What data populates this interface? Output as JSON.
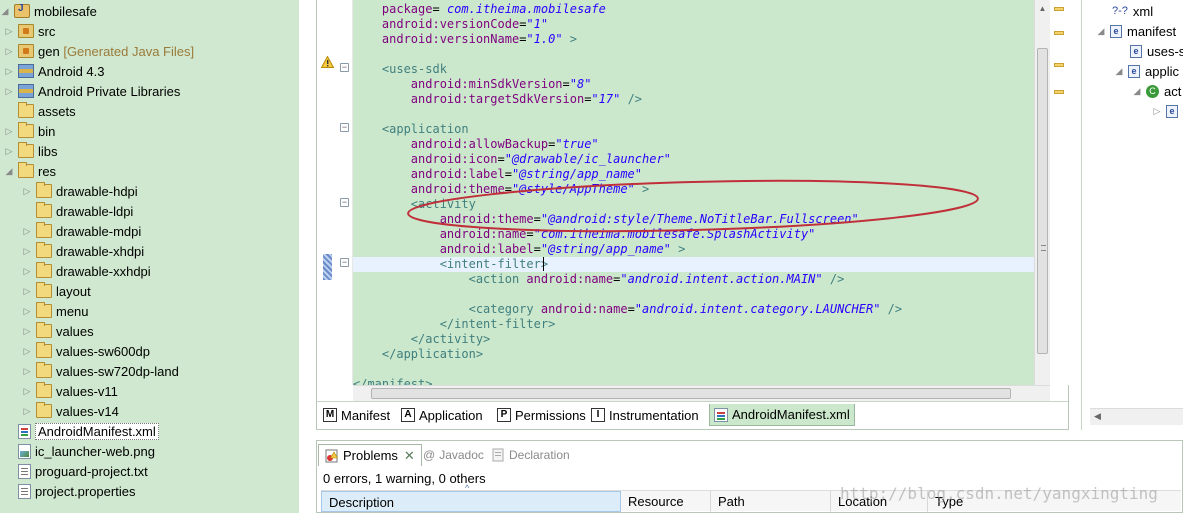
{
  "explorer": {
    "items": [
      {
        "label": "mobilesafe",
        "icon": "project-icon",
        "twisty": "open"
      },
      {
        "label": "src",
        "icon": "source-folder-icon",
        "twisty": "closed"
      },
      {
        "label": "gen",
        "extra": "[Generated Java Files]",
        "icon": "source-folder-icon",
        "twisty": "closed"
      },
      {
        "label": "Android 4.3",
        "icon": "library-icon",
        "twisty": "closed"
      },
      {
        "label": "Android Private Libraries",
        "icon": "library-icon",
        "twisty": "closed"
      },
      {
        "label": "assets",
        "icon": "folder-icon",
        "twisty": "none"
      },
      {
        "label": "bin",
        "icon": "folder-icon",
        "twisty": "closed"
      },
      {
        "label": "libs",
        "icon": "folder-icon",
        "twisty": "closed"
      },
      {
        "label": "res",
        "icon": "folder-icon",
        "twisty": "open"
      },
      {
        "label": "drawable-hdpi",
        "icon": "folder-icon",
        "twisty": "closed"
      },
      {
        "label": "drawable-ldpi",
        "icon": "folder-icon",
        "twisty": "none"
      },
      {
        "label": "drawable-mdpi",
        "icon": "folder-icon",
        "twisty": "closed"
      },
      {
        "label": "drawable-xhdpi",
        "icon": "folder-icon",
        "twisty": "closed"
      },
      {
        "label": "drawable-xxhdpi",
        "icon": "folder-icon",
        "twisty": "closed"
      },
      {
        "label": "layout",
        "icon": "folder-icon",
        "twisty": "closed"
      },
      {
        "label": "menu",
        "icon": "folder-icon",
        "twisty": "closed"
      },
      {
        "label": "values",
        "icon": "folder-icon",
        "twisty": "closed"
      },
      {
        "label": "values-sw600dp",
        "icon": "folder-icon",
        "twisty": "closed"
      },
      {
        "label": "values-sw720dp-land",
        "icon": "folder-icon",
        "twisty": "closed"
      },
      {
        "label": "values-v11",
        "icon": "folder-icon",
        "twisty": "closed"
      },
      {
        "label": "values-v14",
        "icon": "folder-icon",
        "twisty": "closed"
      },
      {
        "label": "AndroidManifest.xml",
        "icon": "xml-file-icon",
        "twisty": "none",
        "selected": true
      },
      {
        "label": "ic_launcher-web.png",
        "icon": "image-file-icon",
        "twisty": "none"
      },
      {
        "label": "proguard-project.txt",
        "icon": "text-file-icon",
        "twisty": "none"
      },
      {
        "label": "project.properties",
        "icon": "text-file-icon",
        "twisty": "none"
      }
    ]
  },
  "editor": {
    "lines": [
      {
        "html": "    <span class='t-attr'>package</span>=<span class='t-val'> com.itheima.mobilesafe</span>"
      },
      {
        "html": "    <span class='t-attr'>android:versionCode</span>=<span class='t-val'>\"1\"</span>"
      },
      {
        "html": "    <span class='t-attr'>android:versionName</span>=<span class='t-val'>\"1.0\"</span> <span class='t-tag'>&gt;</span>"
      },
      {
        "html": ""
      },
      {
        "html": "    <span class='t-tag'>&lt;uses-sdk</span>"
      },
      {
        "html": "        <span class='t-attr'>android:minSdkVersion</span>=<span class='t-val'>\"8\"</span>"
      },
      {
        "html": "        <span class='t-attr'>android:targetSdkVersion</span>=<span class='t-val'>\"17\"</span> <span class='t-tag'>/&gt;</span>"
      },
      {
        "html": ""
      },
      {
        "html": "    <span class='t-tag'>&lt;application</span>"
      },
      {
        "html": "        <span class='t-attr'>android:allowBackup</span>=<span class='t-val'>\"true\"</span>"
      },
      {
        "html": "        <span class='t-attr'>android:icon</span>=<span class='t-val'>\"@drawable/ic_launcher\"</span>"
      },
      {
        "html": "        <span class='t-attr'>android:label</span>=<span class='t-val'>\"@string/app_name\"</span>"
      },
      {
        "html": "        <span class='t-attr'>android:theme</span>=<span class='t-val'>\"@style/AppTheme\"</span> <span class='t-tag'>&gt;</span>"
      },
      {
        "html": "        <span class='t-tag'>&lt;activity</span>"
      },
      {
        "html": "            <span class='t-attr'>android:theme</span>=<span class='t-val'>\"@android:style/Theme.NoTitleBar.Fullscreen\"</span>"
      },
      {
        "html": "            <span class='t-attr'>android:name</span>=<span class='t-val'>\"com.itheima.mobilesafe.SplashActivity\"</span>"
      },
      {
        "html": "            <span class='t-attr'>android:label</span>=<span class='t-val'>\"@string/app_name\"</span> <span class='t-tag'>&gt;</span>"
      },
      {
        "html": "            <span class='t-tag'>&lt;intent-filter&gt;</span>",
        "current": true
      },
      {
        "html": "                <span class='t-tag'>&lt;action</span> <span class='t-attr'>android:name</span>=<span class='t-val'>\"android.intent.action.MAIN\"</span> <span class='t-tag'>/&gt;</span>"
      },
      {
        "html": ""
      },
      {
        "html": "                <span class='t-tag'>&lt;category</span> <span class='t-attr'>android:name</span>=<span class='t-val'>\"android.intent.category.LAUNCHER\"</span> <span class='t-tag'>/&gt;</span>"
      },
      {
        "html": "            <span class='t-tag'>&lt;/intent-filter&gt;</span>"
      },
      {
        "html": "        <span class='t-tag'>&lt;/activity&gt;</span>"
      },
      {
        "html": "    <span class='t-tag'>&lt;/application&gt;</span>"
      },
      {
        "html": ""
      },
      {
        "html": "<span class='t-tag'>&lt;/manifest&gt;</span>"
      }
    ],
    "tabs": [
      {
        "label": "Manifest",
        "icon_letter": "M",
        "name": "tab-manifest"
      },
      {
        "label": "Application",
        "icon_letter": "A",
        "name": "tab-application"
      },
      {
        "label": "Permissions",
        "icon_letter": "P",
        "name": "tab-permissions"
      },
      {
        "label": "Instrumentation",
        "icon_letter": "I",
        "name": "tab-instrumentation"
      },
      {
        "label": "AndroidManifest.xml",
        "icon_letter": "",
        "name": "tab-androidmanifest-xml",
        "active": true
      }
    ]
  },
  "problems": {
    "tabs": [
      {
        "label": "Problems",
        "name": "tab-problems"
      },
      {
        "label": "Javadoc",
        "name": "tab-javadoc"
      },
      {
        "label": "Declaration",
        "name": "tab-declaration"
      }
    ],
    "summary": "0 errors, 1 warning, 0 others",
    "columns": [
      "Description",
      "Resource",
      "Path",
      "Location",
      "Type"
    ],
    "sort_indicator": "^"
  },
  "outline": {
    "items": [
      {
        "label": "xml",
        "prefix": "?-?"
      },
      {
        "label": "manifest",
        "twisty": "open"
      },
      {
        "label": "uses-s"
      },
      {
        "label": "applic",
        "twisty": "open"
      },
      {
        "label": "act",
        "twisty": "open"
      },
      {
        "label": "",
        "twisty": "closed"
      }
    ]
  },
  "watermark": "http://blog.csdn.net/yangxingting",
  "colors": {
    "explorer_bg": "#cfe8cf",
    "editor_bg": "#cce8cc",
    "current_line": "#e8f2fe",
    "annotation_ellipse": "#c0303a"
  }
}
